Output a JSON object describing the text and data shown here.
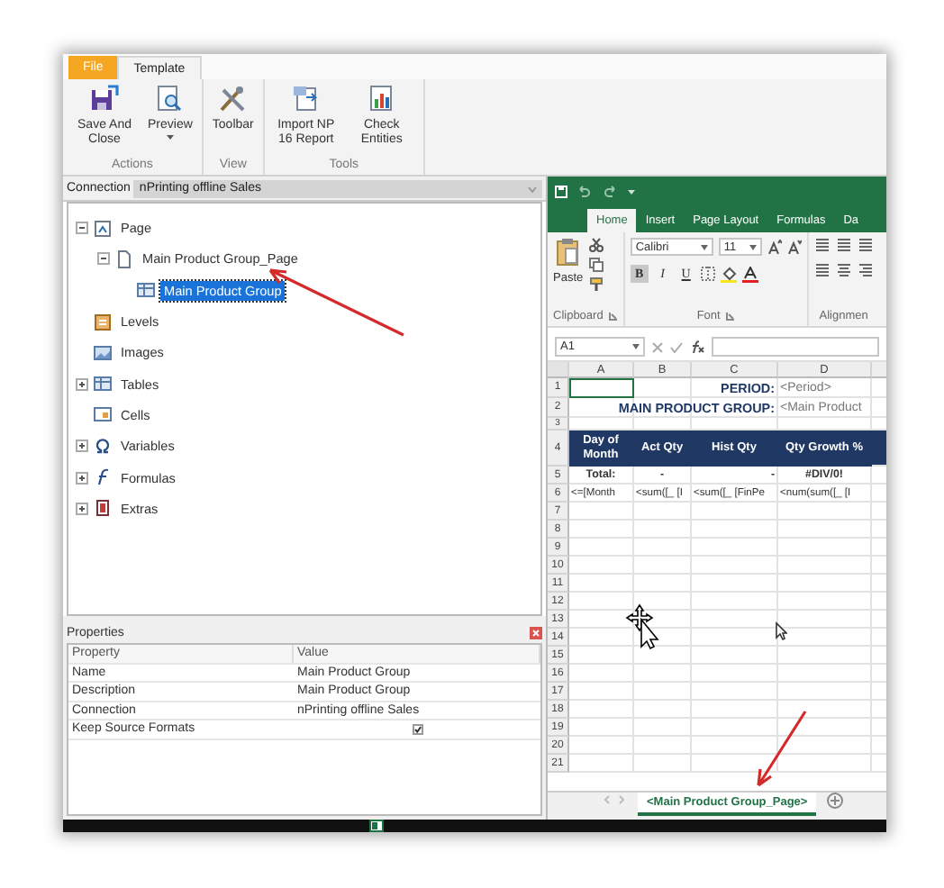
{
  "ribbon": {
    "tabs": [
      {
        "label": "File",
        "kind": "file",
        "selected": false
      },
      {
        "label": "Template",
        "kind": "tab",
        "selected": true
      }
    ],
    "groups": [
      {
        "label": "Actions",
        "buttons": [
          {
            "label": "Save And Close",
            "kind": "save",
            "dropdown": false
          },
          {
            "label": "Preview",
            "kind": "preview",
            "dropdown": true
          }
        ]
      },
      {
        "label": "View",
        "buttons": [
          {
            "label": "Toolbar",
            "kind": "tools",
            "dropdown": false
          }
        ]
      },
      {
        "label": "Tools",
        "buttons": [
          {
            "label": "Import NP 16 Report",
            "kind": "import",
            "dropdown": false
          },
          {
            "label": "Check Entities",
            "kind": "check",
            "dropdown": false
          }
        ]
      }
    ]
  },
  "connection": {
    "label": "Connection",
    "value": "nPrinting offline Sales"
  },
  "tree": [
    {
      "label": "Page",
      "kind": "page",
      "expanded": true,
      "selected": false,
      "children": [
        {
          "label": "Main Product Group_Page",
          "kind": "doc",
          "expanded": true,
          "selected": false,
          "children": [
            {
              "label": "Main Product Group",
              "kind": "table",
              "selected": true
            }
          ]
        }
      ]
    },
    {
      "label": "Levels",
      "kind": "levels",
      "selected": false
    },
    {
      "label": "Images",
      "kind": "images",
      "selected": false
    },
    {
      "label": "Tables",
      "kind": "table",
      "expanded": false,
      "selected": false
    },
    {
      "label": "Cells",
      "kind": "cells",
      "selected": false
    },
    {
      "label": "Variables",
      "kind": "variables",
      "expanded": false,
      "selected": false
    },
    {
      "label": "Formulas",
      "kind": "formulas",
      "expanded": false,
      "selected": false
    },
    {
      "label": "Extras",
      "kind": "extras",
      "expanded": false,
      "selected": false
    }
  ],
  "properties": {
    "title": "Properties",
    "columns": [
      "Property",
      "Value"
    ],
    "rows": [
      {
        "property": "Name",
        "kind": "text",
        "value": "Main Product Group"
      },
      {
        "property": "Description",
        "kind": "text",
        "value": "Main Product Group"
      },
      {
        "property": "Connection",
        "kind": "text",
        "value": "nPrinting offline Sales"
      },
      {
        "property": "Keep Source Formats",
        "kind": "checkbox",
        "checked": true
      }
    ]
  },
  "excel": {
    "tabs": [
      {
        "label": "Home",
        "selected": true
      },
      {
        "label": "Insert",
        "selected": false
      },
      {
        "label": "Page Layout",
        "selected": false
      },
      {
        "label": "Formulas",
        "selected": false
      },
      {
        "label": "Da",
        "selected": false
      }
    ],
    "clipboard": {
      "paste": "Paste",
      "label": "Clipboard"
    },
    "font": {
      "name": "Calibri",
      "size": "11",
      "label": "Font",
      "styles": [
        {
          "label": "B",
          "kind": "bold",
          "selected": true
        },
        {
          "label": "I",
          "kind": "italic",
          "selected": false
        },
        {
          "label": "U",
          "kind": "underline",
          "selected": false
        }
      ]
    },
    "alignment": {
      "label": "Alignmen"
    },
    "name_box": "A1",
    "columns": [
      "A",
      "B",
      "C",
      "D"
    ],
    "rows": [
      {
        "number": "1",
        "kind": "title",
        "cells": [
          {
            "text": "",
            "selected": true
          },
          {
            "text": "",
            "selected": false
          },
          {
            "text": "PERIOD:",
            "selected": false
          },
          {
            "text": "<Period>",
            "selected": false
          }
        ]
      },
      {
        "number": "2",
        "kind": "title",
        "cells": [
          {
            "text": "",
            "selected": false
          },
          {
            "text": "",
            "selected": false
          },
          {
            "text": "MAIN PRODUCT GROUP:",
            "selected": false
          },
          {
            "text": "<Main Product",
            "selected": false
          }
        ]
      },
      {
        "number": "3",
        "kind": "spacer",
        "cells": []
      },
      {
        "number": "4",
        "kind": "header",
        "cells": [
          {
            "text": "Day of Month",
            "selected": false
          },
          {
            "text": "Act Qty",
            "selected": false
          },
          {
            "text": "Hist Qty",
            "selected": false
          },
          {
            "text": "Qty Growth %",
            "selected": false
          }
        ]
      },
      {
        "number": "5",
        "kind": "total",
        "cells": [
          {
            "text": "Total:",
            "selected": false
          },
          {
            "text": "-",
            "selected": false
          },
          {
            "text": "-",
            "selected": false
          },
          {
            "text": "#DIV/0!",
            "selected": false
          }
        ]
      },
      {
        "number": "6",
        "kind": "data",
        "cells": [
          {
            "text": "<=[Month",
            "selected": false
          },
          {
            "text": "<sum([_ [I",
            "selected": false
          },
          {
            "text": "<sum([_ [FinPe",
            "selected": false
          },
          {
            "text": "<num(sum([_ [I",
            "selected": false
          }
        ]
      },
      {
        "number": "7",
        "kind": "data",
        "cells": []
      },
      {
        "number": "8",
        "kind": "data",
        "cells": []
      },
      {
        "number": "9",
        "kind": "data",
        "cells": []
      },
      {
        "number": "10",
        "kind": "data",
        "cells": []
      },
      {
        "number": "11",
        "kind": "data",
        "cells": []
      },
      {
        "number": "12",
        "kind": "data",
        "cells": []
      },
      {
        "number": "13",
        "kind": "data",
        "cells": []
      },
      {
        "number": "14",
        "kind": "data",
        "cells": []
      },
      {
        "number": "15",
        "kind": "data",
        "cells": []
      },
      {
        "number": "16",
        "kind": "data",
        "cells": []
      },
      {
        "number": "17",
        "kind": "data",
        "cells": []
      },
      {
        "number": "18",
        "kind": "data",
        "cells": []
      },
      {
        "number": "19",
        "kind": "data",
        "cells": []
      },
      {
        "number": "20",
        "kind": "data",
        "cells": []
      },
      {
        "number": "21",
        "kind": "data",
        "cells": []
      }
    ],
    "sheets": [
      {
        "label": "<Main Product Group_Page>",
        "selected": true
      }
    ]
  }
}
